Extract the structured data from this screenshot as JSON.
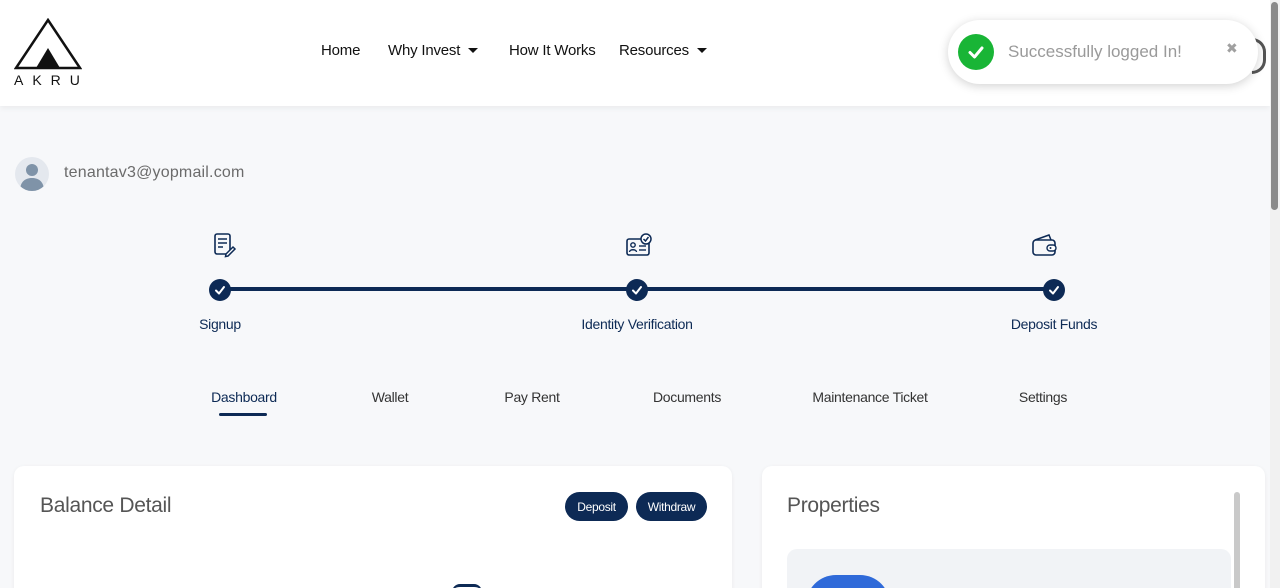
{
  "brand": {
    "logo_text": "AKRU"
  },
  "nav": {
    "items": [
      {
        "label": "Home",
        "has_dropdown": false
      },
      {
        "label": "Why Invest",
        "has_dropdown": true
      },
      {
        "label": "How It Works",
        "has_dropdown": false
      },
      {
        "label": "Resources",
        "has_dropdown": true
      }
    ]
  },
  "toast": {
    "message": "Successfully logged In!",
    "close_glyph": "✖",
    "icon": "check-circle-icon",
    "color": "#19b536"
  },
  "user": {
    "email": "tenantav3@yopmail.com",
    "avatar_icon": "user-avatar-icon"
  },
  "progress": {
    "steps": [
      {
        "label": "Signup",
        "icon": "signup-form-icon",
        "done": true
      },
      {
        "label": "Identity Verification",
        "icon": "id-card-verified-icon",
        "done": true
      },
      {
        "label": "Deposit Funds",
        "icon": "wallet-icon",
        "done": true
      }
    ],
    "accent": "#0d2a55"
  },
  "tabs": {
    "active": "Dashboard",
    "items": [
      "Dashboard",
      "Wallet",
      "Pay Rent",
      "Documents",
      "Maintenance Ticket",
      "Settings"
    ]
  },
  "balance_card": {
    "title": "Balance Detail",
    "deposit_label": "Deposit",
    "withdraw_label": "Withdraw"
  },
  "properties_card": {
    "title": "Properties"
  }
}
